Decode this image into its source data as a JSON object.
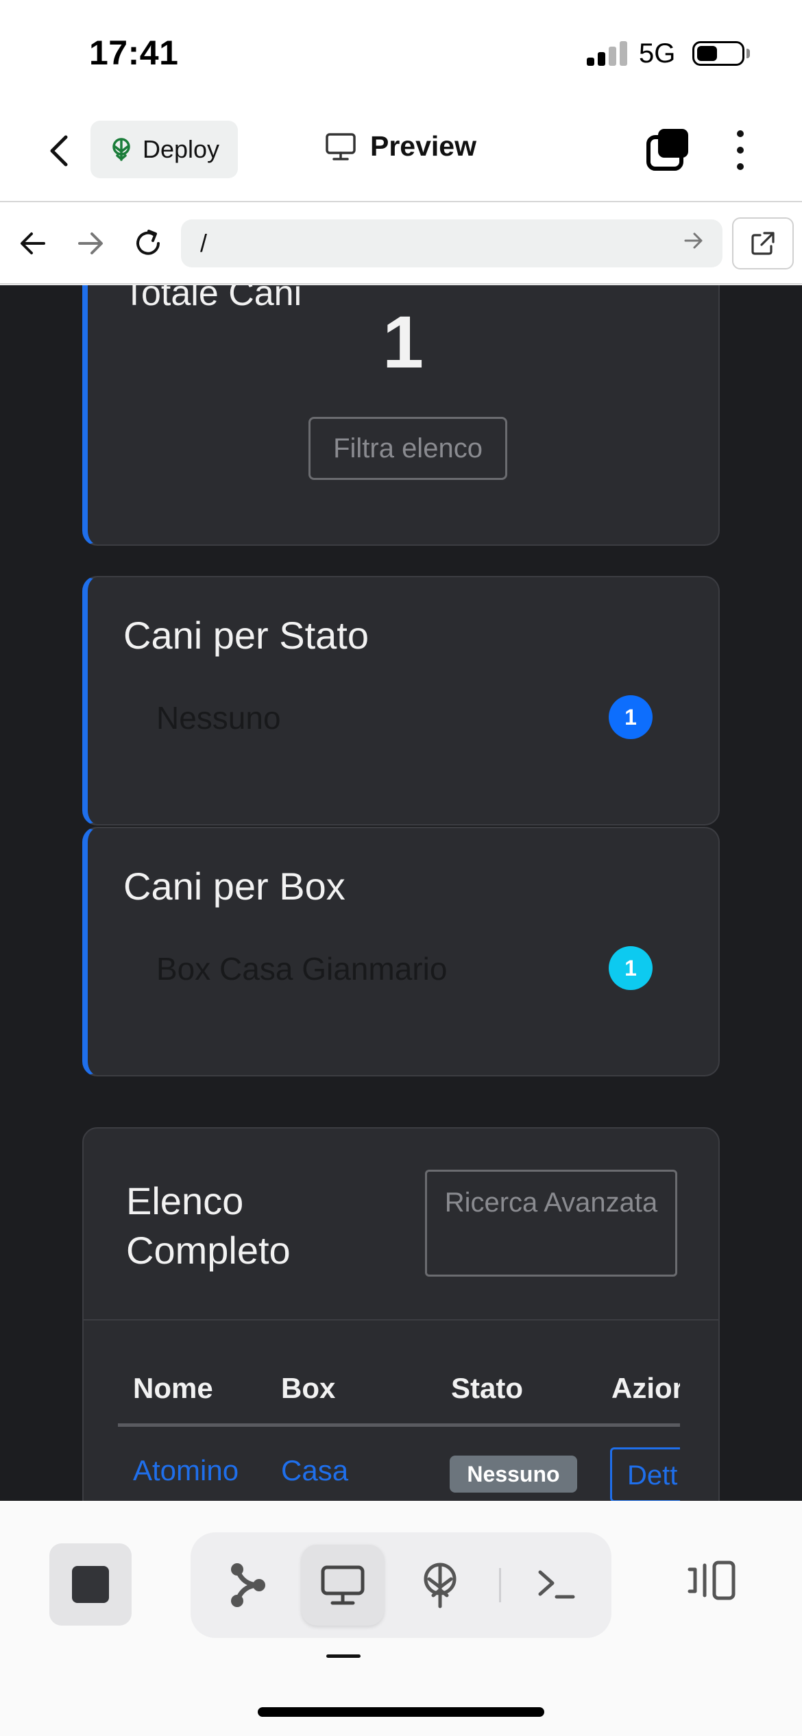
{
  "status_bar": {
    "time": "17:41",
    "network": "5G",
    "battery_level": 0.45
  },
  "header": {
    "back_icon": "chevron-left-icon",
    "deploy_label": "Deploy",
    "deploy_icon": "deploy-tree-icon",
    "preview_label": "Preview",
    "preview_icon": "monitor-icon",
    "tabs_icon": "tabs-icon",
    "menu_icon": "more-vertical-icon"
  },
  "browser": {
    "url": "/",
    "back_icon": "arrow-left-icon",
    "forward_icon": "arrow-right-icon",
    "reload_icon": "reload-icon",
    "open_icon": "external-link-icon"
  },
  "page": {
    "total_card": {
      "title": "Totale Cani",
      "value": "1",
      "filter_label": "Filtra elenco"
    },
    "stato_card": {
      "title": "Cani per Stato",
      "row_label": "Nessuno",
      "row_count": "1",
      "badge_color": "#0d6efd"
    },
    "box_card": {
      "title": "Cani per Box",
      "row_label": "Box Casa Gianmario",
      "row_count": "1",
      "badge_color": "#0dcaf0"
    },
    "list": {
      "title": "Elenco Completo",
      "advanced_search_label": "Ricerca Avanzata",
      "columns": [
        "Nome",
        "Box",
        "Stato",
        "Azior"
      ],
      "rows": [
        {
          "nome": "Atomino",
          "box": "Casa",
          "stato": "Nessuno",
          "azione": "Dett"
        }
      ]
    }
  },
  "bottom_bar": {
    "stop_icon": "stop-icon",
    "tools": [
      "git-branch-icon",
      "monitor-icon",
      "deploy-icon",
      "terminal-icon"
    ],
    "active_tool": "monitor-icon",
    "side_icon": "side-panel-icon"
  }
}
